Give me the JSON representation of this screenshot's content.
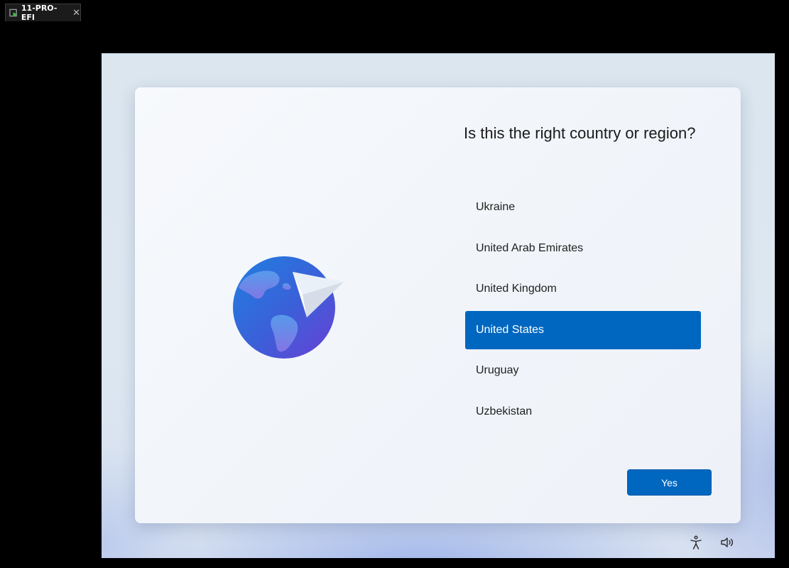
{
  "vm_tab": {
    "label": "11-PRO-EFI",
    "close_glyph": "✕",
    "icon": "vm-play-icon"
  },
  "dialog": {
    "title": "Is this the right country or region?",
    "regions": [
      {
        "label": "Ukraine",
        "selected": false
      },
      {
        "label": "United Arab Emirates",
        "selected": false
      },
      {
        "label": "United Kingdom",
        "selected": false
      },
      {
        "label": "United States",
        "selected": true
      },
      {
        "label": "Uruguay",
        "selected": false
      },
      {
        "label": "Uzbekistan",
        "selected": false
      }
    ],
    "yes_label": "Yes",
    "illustration": "globe-paper-plane-icon"
  },
  "footer": {
    "accessibility_icon": "accessibility-icon",
    "volume_icon": "volume-icon"
  },
  "colors": {
    "accent": "#0067c0",
    "background": "#dbe6ef",
    "dialog": "#f5f8fb",
    "text": "#1a1a1a"
  }
}
